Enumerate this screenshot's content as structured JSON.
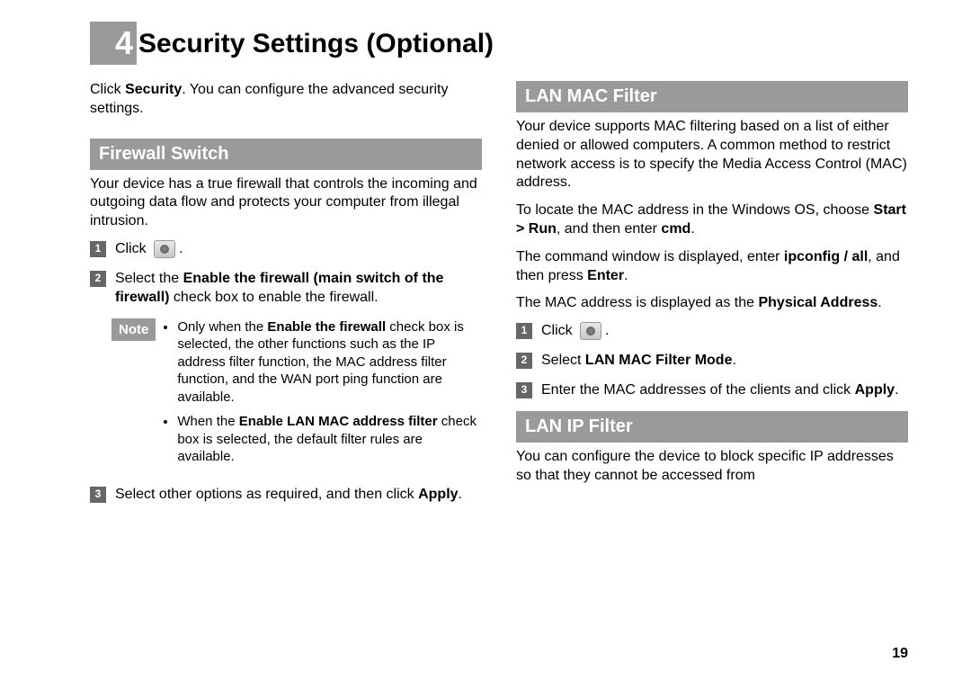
{
  "chapter": {
    "number": "4",
    "title": "Security Settings (Optional)"
  },
  "intro_pre": "Click ",
  "intro_bold": "Security",
  "intro_post": ". You can configure the advanced security settings.",
  "firewall": {
    "heading": "Firewall Switch",
    "desc": "Your device has a true firewall that controls the incoming and outgoing data flow and protects your computer from illegal intrusion.",
    "step1_pre": "Click ",
    "step1_post": ".",
    "step2_pre": "Select the ",
    "step2_bold": "Enable the firewall (main switch of the firewall)",
    "step2_post": " check box to enable the firewall.",
    "note_label": "Note",
    "note1_a": "Only when the ",
    "note1_b": "Enable the firewall",
    "note1_c": " check box is selected, the other functions such as the IP address filter function, the MAC address filter function, and the WAN port ping function are available.",
    "note2_a": "When the ",
    "note2_b": "Enable LAN MAC address filter",
    "note2_c": " check box is selected, the default filter rules are available.",
    "step3_pre": "Select other options as required, and then click ",
    "step3_bold": "Apply",
    "step3_post": "."
  },
  "macfilter": {
    "heading": "LAN MAC Filter",
    "p1": "Your device supports MAC filtering based on a list of either denied or allowed computers. A common method to restrict network access is to specify the Media Access Control (MAC) address.",
    "p2_a": "To locate the MAC address in the Windows OS, choose ",
    "p2_b": "Start > Run",
    "p2_c": ", and then enter ",
    "p2_d": "cmd",
    "p2_e": ".",
    "p3_a": "The command window is displayed, enter ",
    "p3_b": "ipconfig / all",
    "p3_c": ", and then press ",
    "p3_d": "Enter",
    "p3_e": ".",
    "p4_a": "The MAC address is displayed as the ",
    "p4_b": "Physical Address",
    "p4_c": ".",
    "step1_pre": "Click ",
    "step1_post": ".",
    "step2_pre": "Select ",
    "step2_bold": "LAN MAC Filter Mode",
    "step2_post": ".",
    "step3_pre": "Enter the MAC addresses of the clients and click ",
    "step3_bold": "Apply",
    "step3_post": "."
  },
  "ipfilter": {
    "heading": "LAN IP Filter",
    "p1": "You can configure the device to block specific IP addresses so that they cannot be accessed from"
  },
  "page_number": "19"
}
